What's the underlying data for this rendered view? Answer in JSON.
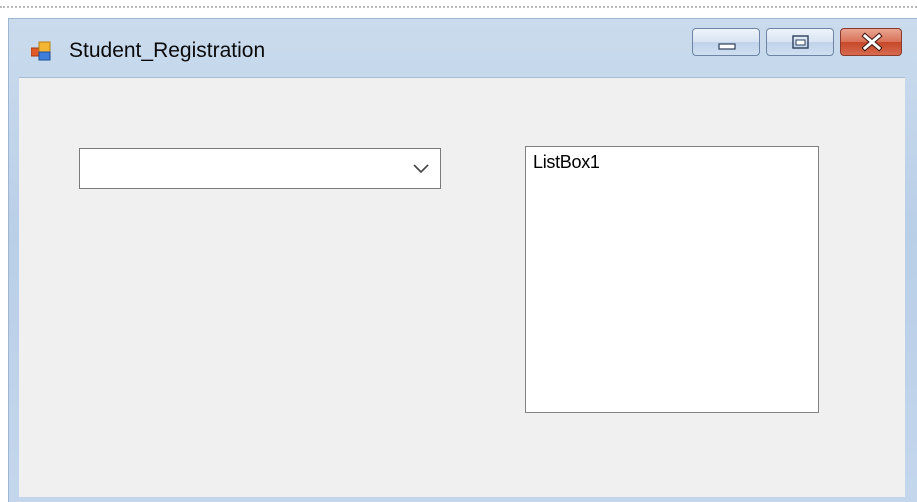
{
  "window": {
    "title": "Student_Registration",
    "icon": "form-icon"
  },
  "caption_buttons": {
    "minimize": "minimize-icon",
    "maximize": "maximize-icon",
    "close": "close-icon"
  },
  "combobox": {
    "value": "",
    "arrow_icon": "chevron-down-icon"
  },
  "listbox": {
    "items": [
      "ListBox1"
    ]
  },
  "colors": {
    "client_background": "#f0f0f0",
    "titlebar": "#c3d6ec",
    "close_button": "#c7492a"
  }
}
